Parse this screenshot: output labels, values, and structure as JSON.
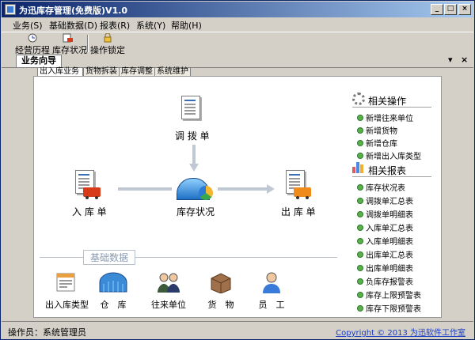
{
  "window": {
    "title": "为迅库存管理(免费版)V1.0",
    "controls": {
      "minimize": "_",
      "maximize": "□",
      "close": "×"
    }
  },
  "menu": [
    "业务(S)",
    "基础数据(D)",
    "报表(R)",
    "系统(Y)",
    "帮助(H)"
  ],
  "toolbar": [
    {
      "label": "经营历程",
      "icon": "history-icon"
    },
    {
      "label": "库存状况",
      "icon": "inventory-icon"
    },
    {
      "label": "操作锁定",
      "icon": "lock-icon"
    }
  ],
  "doc_tab": {
    "label": "业务向导",
    "dropdown": "▾",
    "close": "×"
  },
  "inner_tabs": [
    "出入库业务",
    "货物拆装",
    "库存调整",
    "系统维护"
  ],
  "flow": {
    "transfer": "调 拨 单",
    "in": "入 库 单",
    "stock": "库存状况",
    "out": "出 库 单"
  },
  "related_ops": {
    "title": "相关操作",
    "items": [
      "新增往来单位",
      "新增货物",
      "新增仓库",
      "新增出入库类型"
    ]
  },
  "related_reports": {
    "title": "相关报表",
    "items": [
      "库存状况表",
      "调拨单汇总表",
      "调拨单明细表",
      "入库单汇总表",
      "入库单明细表",
      "出库单汇总表",
      "出库单明细表",
      "负库存报警表",
      "库存上限预警表",
      "库存下限预警表"
    ]
  },
  "base_data": {
    "title": "基础数据",
    "items": [
      {
        "label": "出入库类型",
        "icon": "in-out-type-icon"
      },
      {
        "label": "仓　库",
        "icon": "warehouse-icon"
      },
      {
        "label": "往来单位",
        "icon": "contacts-icon"
      },
      {
        "label": "货　物",
        "icon": "goods-box-icon"
      },
      {
        "label": "员　工",
        "icon": "employee-icon"
      }
    ]
  },
  "status": {
    "operator": "操作员：系统管理员",
    "copyright": "Copyright © 2013 为迅软件工作室"
  },
  "colors": {
    "accent": "#0a246a",
    "flow_line": "#c0c8d4",
    "link": "#1a3cc0"
  }
}
